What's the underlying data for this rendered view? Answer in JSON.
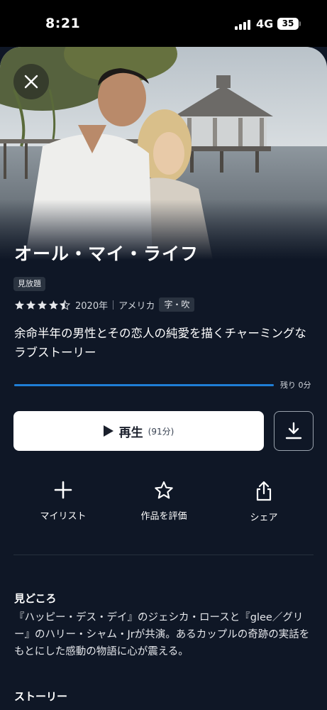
{
  "status_bar": {
    "time": "8:21",
    "network": "4G",
    "battery": "35"
  },
  "hero": {
    "image": "couple-by-lake-gazebo-photo",
    "close_icon": "close-icon"
  },
  "title": "オール・マイ・ライフ",
  "badge": "見放題",
  "rating": {
    "value": 4.5,
    "max": 5
  },
  "year": "2020年",
  "country": "アメリカ",
  "audio_subs": "字・吹",
  "catchcopy": "余命半年の男性とその恋人の純愛を描くチャーミングなラブストーリー",
  "progress": {
    "fraction": 1.0,
    "remaining_label": "残り 0分"
  },
  "play": {
    "label": "再生",
    "duration": "(91分)"
  },
  "actions": [
    {
      "label": "マイリスト",
      "icon": "plus-icon"
    },
    {
      "label": "作品を評価",
      "icon": "star-outline-icon"
    },
    {
      "label": "シェア",
      "icon": "share-icon"
    }
  ],
  "highlights": {
    "title": "見どころ",
    "text": "『ハッピー・デス・デイ』のジェシカ・ロースと『glee／グリー』のハリー・シャム・Jrが共演。あるカップルの奇跡の実話をもとにした感動の物語に心が震える。"
  },
  "story": {
    "title": "ストーリー"
  },
  "colors": {
    "background": "#0f1726",
    "accent": "#1f7ed6",
    "button": "#ffffff"
  }
}
